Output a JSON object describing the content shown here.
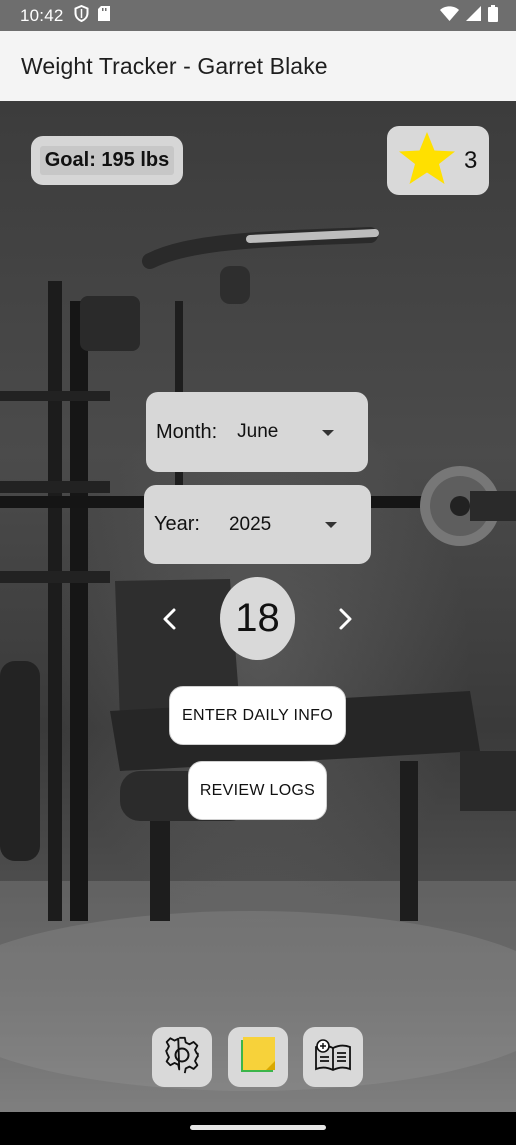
{
  "status_bar": {
    "time": "10:42",
    "icons_left": [
      "shield-icon",
      "sd-card-icon"
    ],
    "icons_right": [
      "wifi-icon",
      "signal-icon",
      "battery-icon"
    ]
  },
  "app_bar": {
    "title": "Weight Tracker - Garret Blake"
  },
  "goal": {
    "label": "Goal: 195 lbs"
  },
  "stars": {
    "count": "3",
    "icon": "star-icon",
    "color": "#FFE000"
  },
  "date_picker": {
    "month_label": "Month:",
    "month_value": "June",
    "year_label": "Year:",
    "year_value": "2025",
    "day": "18"
  },
  "actions": {
    "enter_daily_info": "ENTER DAILY INFO",
    "review_logs": "REVIEW LOGS"
  },
  "bottom_icons": [
    "gear-icon",
    "sticky-note-icon",
    "book-icon"
  ],
  "colors": {
    "card_bg": "#D9D9D9",
    "app_bar_bg": "#F4F4F4",
    "status_bar_bg": "#6E6E6E"
  }
}
